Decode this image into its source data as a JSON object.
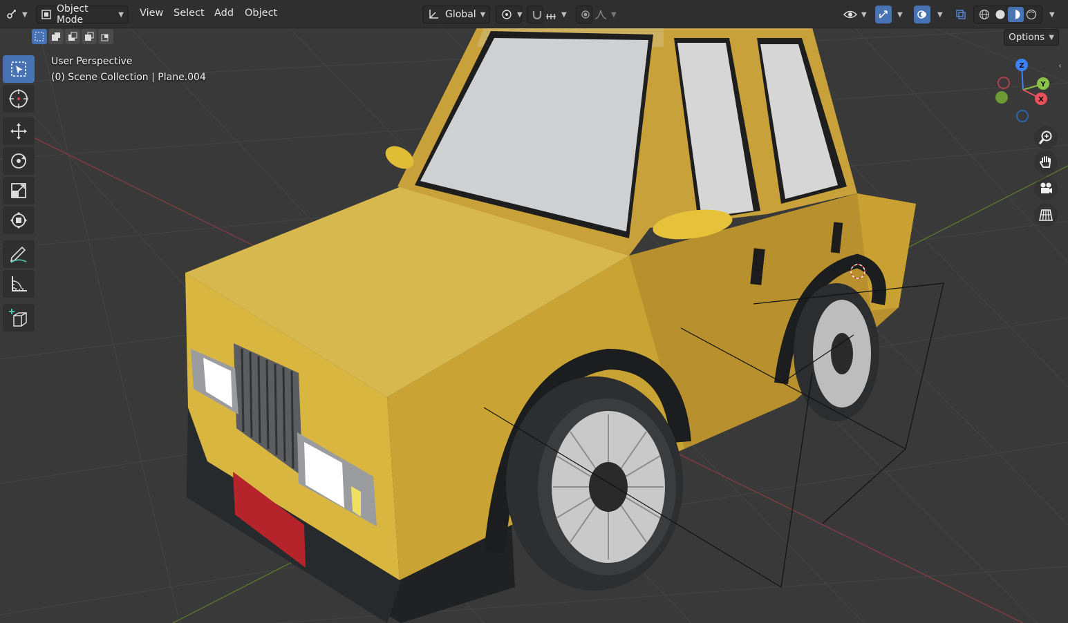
{
  "header": {
    "mode_label": "Object Mode",
    "menus": [
      "View",
      "Select",
      "Add",
      "Object"
    ],
    "transform_orientation": "Global"
  },
  "viewport": {
    "view_name": "User Perspective",
    "collection_info": "(0) Scene Collection | Plane.004"
  },
  "options_label": "Options",
  "toolbar": {
    "tools": [
      {
        "name": "select-box",
        "icon": "select-box-icon",
        "active": true
      },
      {
        "name": "cursor",
        "icon": "cursor-icon",
        "active": false
      },
      {
        "name": "move",
        "icon": "move-icon",
        "active": false
      },
      {
        "name": "rotate",
        "icon": "rotate-icon",
        "active": false
      },
      {
        "name": "scale",
        "icon": "scale-icon",
        "active": false
      },
      {
        "name": "transform",
        "icon": "transform-icon",
        "active": false
      },
      {
        "name": "annotate",
        "icon": "annotate-icon",
        "active": false
      },
      {
        "name": "measure",
        "icon": "measure-icon",
        "active": false
      },
      {
        "name": "add-cube",
        "icon": "add-cube-icon",
        "active": false
      }
    ]
  },
  "gizmo": {
    "x_label": "X",
    "y_label": "Y",
    "z_label": "Z"
  },
  "colors": {
    "accent": "#4772b3",
    "viewport_bg": "#393939",
    "car_body": "#d4b13c",
    "x_axis": "#e8505b",
    "y_axis": "#8bc34a",
    "z_axis": "#3b82f6"
  },
  "navigation": [
    "zoom-icon",
    "pan-hand-icon",
    "camera-icon",
    "grid-icon"
  ]
}
